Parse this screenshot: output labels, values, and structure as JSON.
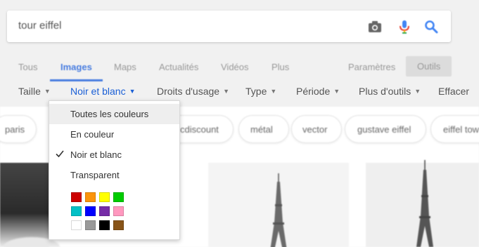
{
  "search": {
    "query": "tour eiffel"
  },
  "tabs": [
    {
      "label": "Tous"
    },
    {
      "label": "Images"
    },
    {
      "label": "Maps"
    },
    {
      "label": "Actualités"
    },
    {
      "label": "Vidéos"
    },
    {
      "label": "Plus"
    }
  ],
  "settings_label": "Paramètres",
  "tools_label": "Outils",
  "tools": [
    {
      "label": "Taille"
    },
    {
      "label": "Noir et blanc"
    },
    {
      "label": "Droits d'usage"
    },
    {
      "label": "Type"
    },
    {
      "label": "Période"
    },
    {
      "label": "Plus d'outils"
    }
  ],
  "clear_label": "Effacer",
  "color_menu": {
    "items": [
      {
        "label": "Toutes les couleurs",
        "checked": false,
        "highlighted": true
      },
      {
        "label": "En couleur",
        "checked": false,
        "highlighted": false
      },
      {
        "label": "Noir et blanc",
        "checked": true,
        "highlighted": false
      },
      {
        "label": "Transparent",
        "checked": false,
        "highlighted": false
      }
    ],
    "swatches": [
      [
        "#cc0000",
        "#fb940b",
        "#ffff00",
        "#00cc00"
      ],
      [
        "#03c0c6",
        "#0000ff",
        "#762ca7",
        "#ff98bf"
      ],
      [
        "#ffffff",
        "#999999",
        "#000000",
        "#885418"
      ]
    ]
  },
  "chips": [
    "paris",
    "cdiscount",
    "métal",
    "vector",
    "gustave eiffel",
    "eiffel tow"
  ],
  "colors": {
    "accent": "#1a5fd6",
    "tab_active": "#4a7ee0"
  }
}
